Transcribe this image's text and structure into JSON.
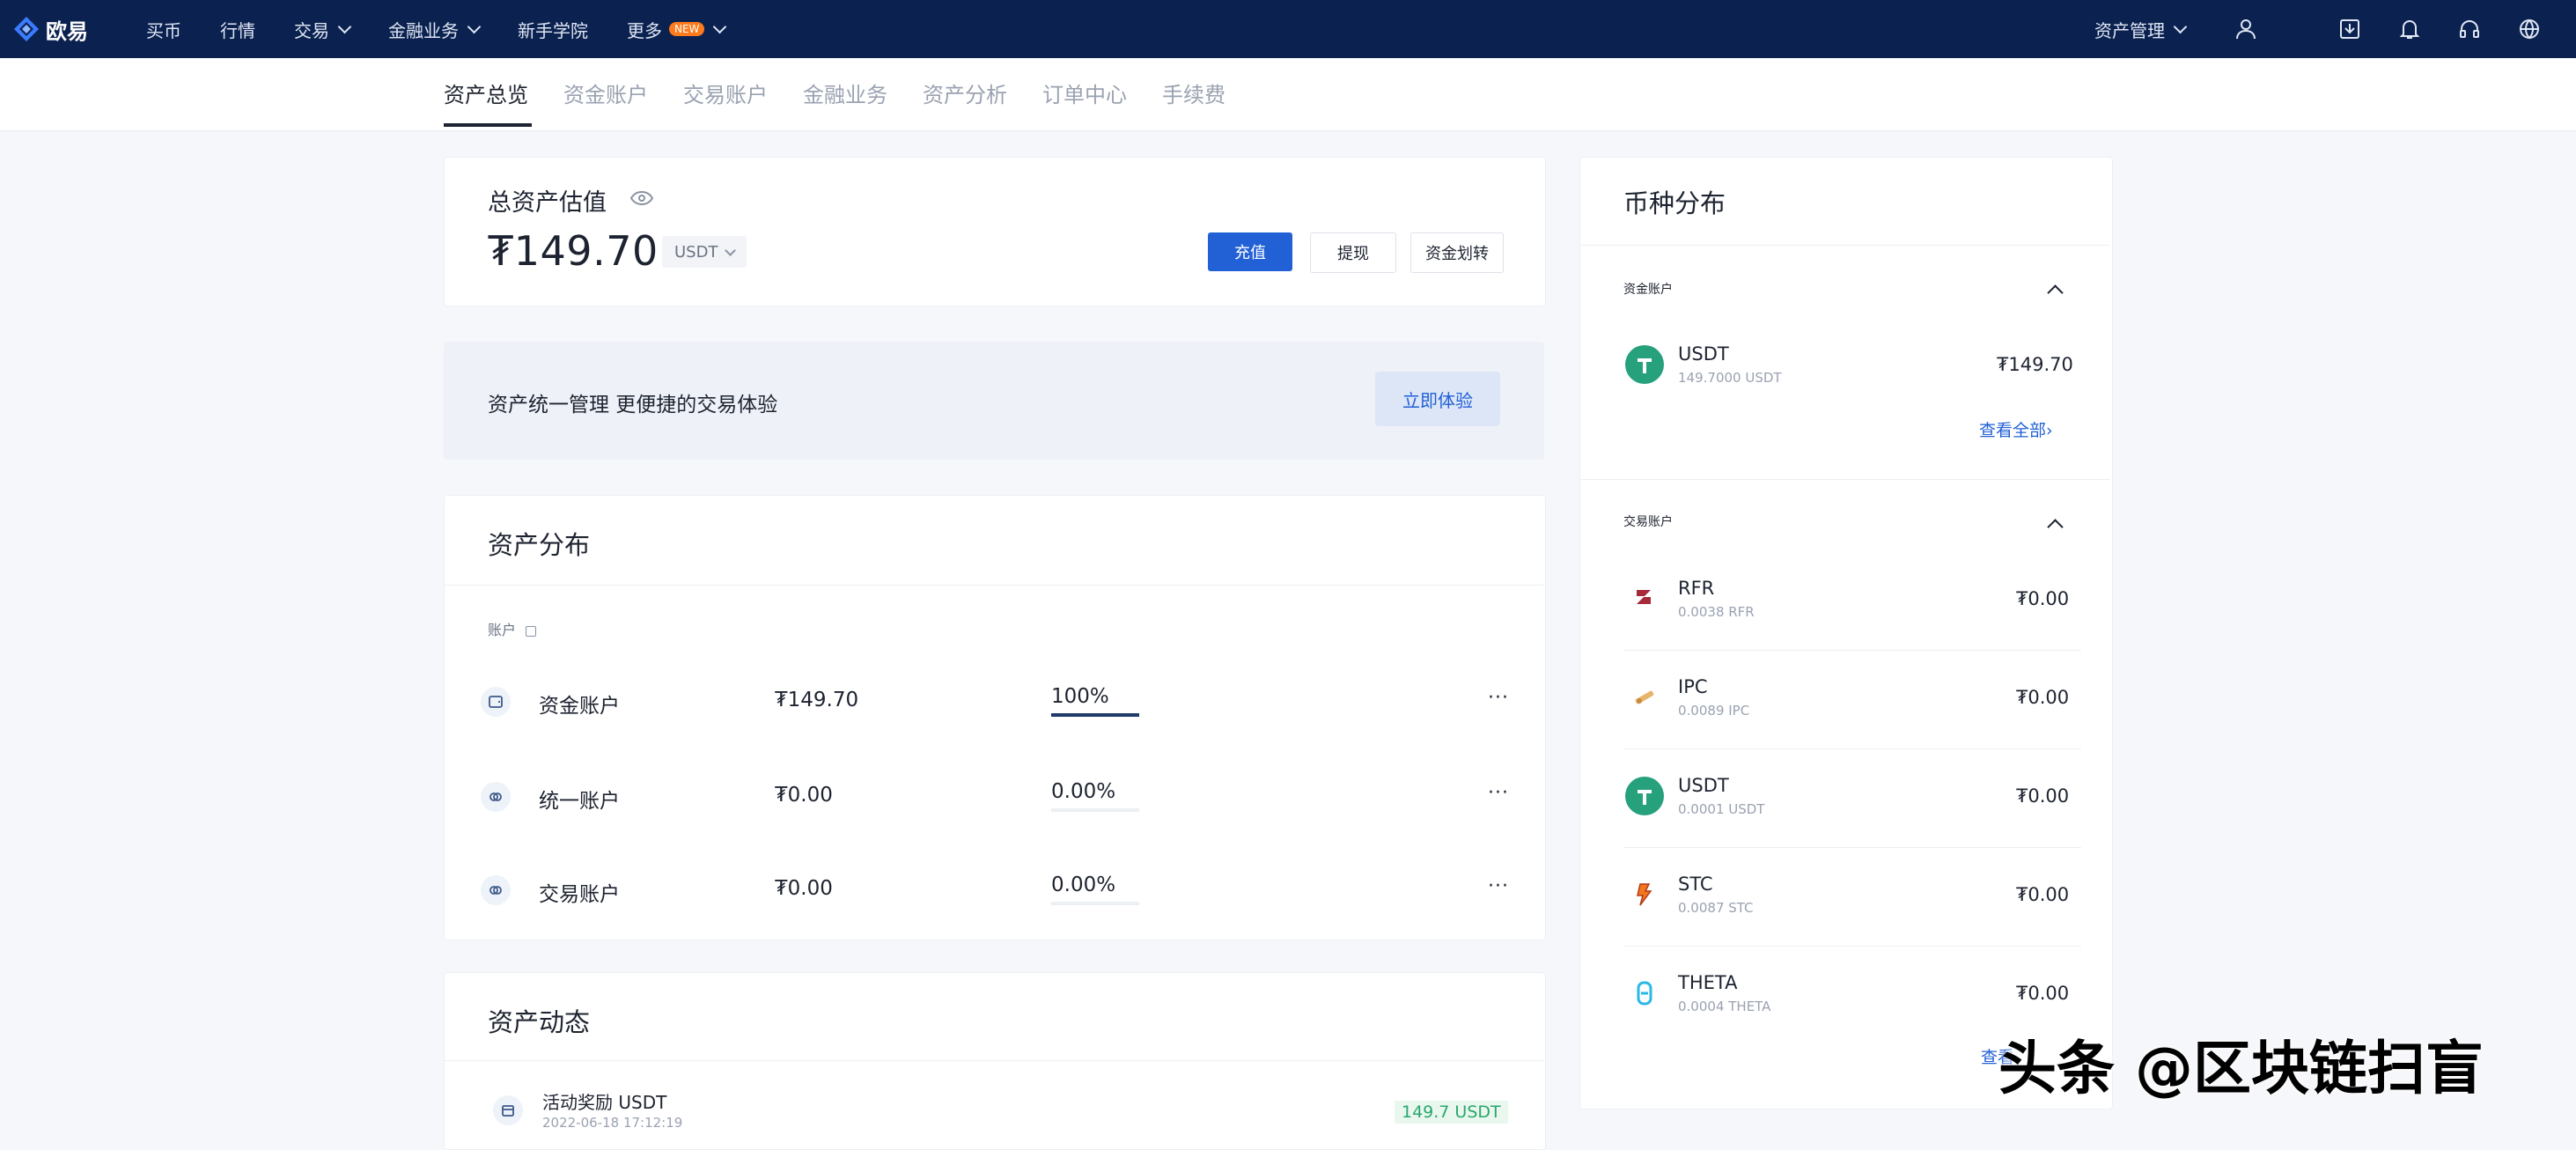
{
  "topbar": {
    "brand": "欧易",
    "nav": [
      {
        "label": "买币",
        "dropdown": false,
        "badge": ""
      },
      {
        "label": "行情",
        "dropdown": false,
        "badge": ""
      },
      {
        "label": "交易",
        "dropdown": true,
        "badge": ""
      },
      {
        "label": "金融业务",
        "dropdown": true,
        "badge": ""
      },
      {
        "label": "新手学院",
        "dropdown": false,
        "badge": ""
      },
      {
        "label": "更多",
        "dropdown": true,
        "badge": "NEW"
      }
    ],
    "asset_management": "资产管理",
    "icons": [
      "user-icon",
      "download-icon",
      "bell-icon",
      "headset-icon",
      "globe-icon"
    ],
    "colors": {
      "background": "#0b2250",
      "accent": "#2260d6"
    }
  },
  "subtabs": [
    "资产总览",
    "资金账户",
    "交易账户",
    "金融业务",
    "资产分析",
    "订单中心",
    "手续费"
  ],
  "total": {
    "title": "总资产估值",
    "amount": "₮149.70",
    "currency": "USDT",
    "buttons": {
      "deposit": "充值",
      "withdraw": "提现",
      "transfer": "资金划转"
    }
  },
  "banner": {
    "text": "资产统一管理 更便捷的交易体验",
    "button": "立即体验"
  },
  "distribution": {
    "title": "资产分布",
    "filter_label": "账户",
    "rows": [
      {
        "name": "资金账户",
        "amount": "₮149.70",
        "percent": "100%",
        "fill": 1.0,
        "more": "···"
      },
      {
        "name": "统一账户",
        "amount": "₮0.00",
        "percent": "0.00%",
        "fill": 0.0,
        "more": "···"
      },
      {
        "name": "交易账户",
        "amount": "₮0.00",
        "percent": "0.00%",
        "fill": 0.0,
        "more": "···"
      }
    ]
  },
  "activity": {
    "title": "资产动态",
    "items": [
      {
        "label": "活动奖励 USDT",
        "time": "2022-06-18 17:12:19",
        "amount": "149.7 USDT"
      }
    ]
  },
  "coins": {
    "title": "币种分布",
    "funding": {
      "label": "资金账户",
      "items": [
        {
          "name": "USDT",
          "sub": "149.7000 USDT",
          "value": "₮149.70",
          "logo": "tether-icon"
        }
      ],
      "view_all": "查看全部›"
    },
    "trading": {
      "label": "交易账户",
      "items": [
        {
          "name": "RFR",
          "sub": "0.0038 RFR",
          "value": "₮0.00",
          "logo": "rfr-icon"
        },
        {
          "name": "IPC",
          "sub": "0.0089 IPC",
          "value": "₮0.00",
          "logo": "ipc-icon"
        },
        {
          "name": "USDT",
          "sub": "0.0001 USDT",
          "value": "₮0.00",
          "logo": "tether-icon"
        },
        {
          "name": "STC",
          "sub": "0.0087 STC",
          "value": "₮0.00",
          "logo": "stc-icon"
        },
        {
          "name": "THETA",
          "sub": "0.0004 THETA",
          "value": "₮0.00",
          "logo": "theta-icon"
        }
      ],
      "view_all": "查看"
    }
  },
  "watermark": "头条 @区块链扫盲"
}
